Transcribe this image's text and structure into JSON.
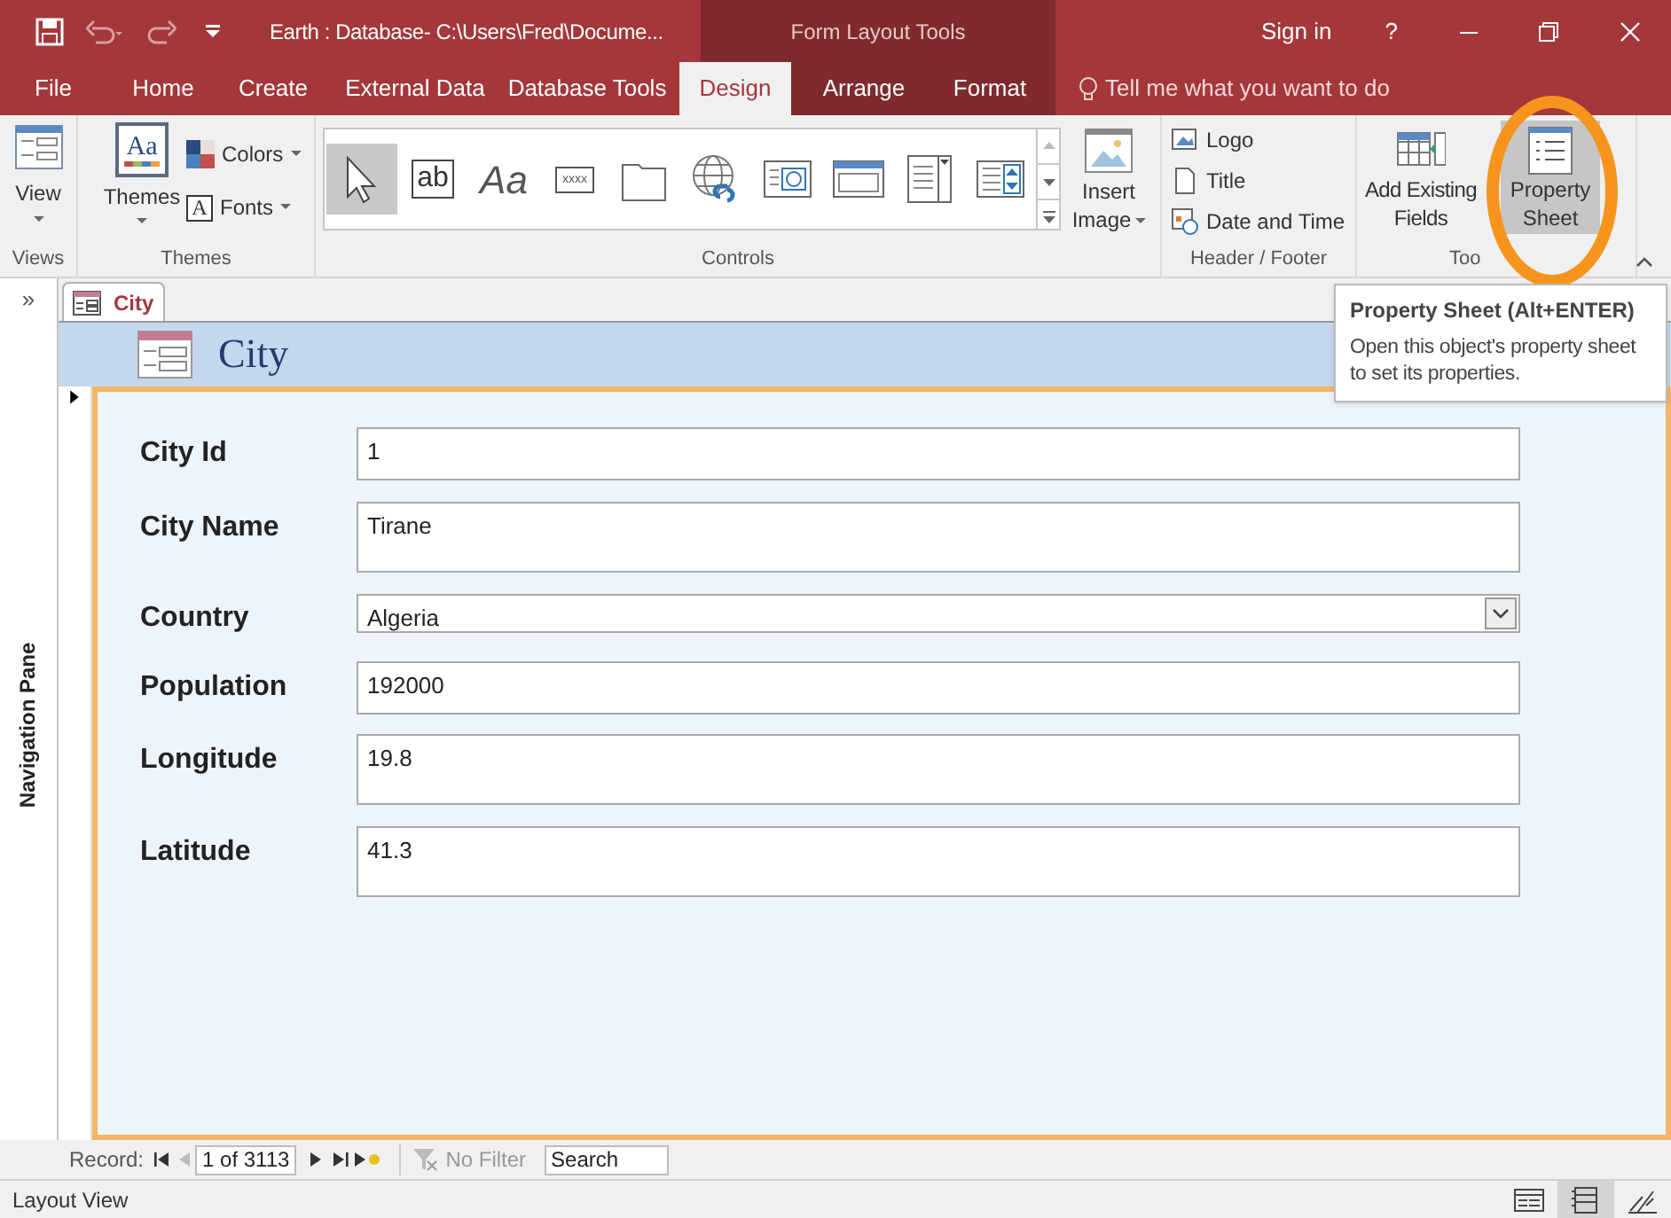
{
  "title_bar": {
    "title": "Earth : Database- C:\\Users\\Fred\\Docume...",
    "contextual_group": "Form Layout Tools",
    "sign_in": "Sign in",
    "help": "?",
    "undo_disabled": true
  },
  "ribbon_tabs": [
    {
      "label": "File",
      "selected": false
    },
    {
      "label": "Home",
      "selected": false
    },
    {
      "label": "Create",
      "selected": false
    },
    {
      "label": "External Data",
      "selected": false
    },
    {
      "label": "Database Tools",
      "selected": false
    },
    {
      "label": "Design",
      "selected": true
    },
    {
      "label": "Arrange",
      "selected": false
    },
    {
      "label": "Format",
      "selected": false
    }
  ],
  "tell_me": "Tell me what you want to do",
  "ribbon": {
    "views": {
      "label": "Views",
      "button": "View"
    },
    "themes": {
      "label": "Themes",
      "button": "Themes",
      "themes_glyph": "Aa",
      "colors": "Colors",
      "fonts": "Fonts",
      "fonts_glyph": "A"
    },
    "controls": {
      "label": "Controls",
      "items": [
        {
          "kind": "pointer",
          "selected": true
        },
        {
          "kind": "textbox",
          "glyph": "ab",
          "selected": false
        },
        {
          "kind": "label",
          "glyph": "Aa",
          "selected": false
        },
        {
          "kind": "button",
          "glyph": "xxxx",
          "selected": false
        },
        {
          "kind": "tab",
          "selected": false
        },
        {
          "kind": "hyperlink",
          "selected": false
        },
        {
          "kind": "web",
          "selected": false
        },
        {
          "kind": "navigation",
          "selected": false
        },
        {
          "kind": "listbox",
          "selected": false
        },
        {
          "kind": "combo",
          "selected": false
        }
      ]
    },
    "insert_image": "Insert Image",
    "header_footer": {
      "label": "Header / Footer",
      "items": [
        {
          "kind": "logo",
          "label": "Logo"
        },
        {
          "kind": "title",
          "label": "Title"
        },
        {
          "kind": "datetime",
          "label": "Date and Time"
        }
      ]
    },
    "tools": {
      "label": "Too",
      "buttons": [
        {
          "label": "Add Existing Fields",
          "selected": false
        },
        {
          "label": "Property Sheet",
          "selected": true
        }
      ]
    }
  },
  "tooltip": {
    "title": "Property Sheet (Alt+ENTER)",
    "text": "Open this object's property sheet to set its properties."
  },
  "nav_pane": {
    "label": "Navigation Pane",
    "toggle": "»"
  },
  "document_tab": {
    "label": "City",
    "selected": true
  },
  "form": {
    "title": "City",
    "fields": [
      {
        "label": "City Id",
        "value": "1",
        "kind": "text"
      },
      {
        "label": "City Name",
        "value": "Tirane",
        "kind": "tall"
      },
      {
        "label": "Country",
        "value": "Algeria",
        "kind": "combo"
      },
      {
        "label": "Population",
        "value": "192000",
        "kind": "text"
      },
      {
        "label": "Longitude",
        "value": "19.8",
        "kind": "tall"
      },
      {
        "label": "Latitude",
        "value": "41.3",
        "kind": "tall"
      }
    ]
  },
  "record_nav": {
    "label": "Record:",
    "position": "1 of 3113",
    "filter": "No Filter",
    "search_placeholder": "Search"
  },
  "status_bar": {
    "text": "Layout View",
    "views": [
      {
        "kind": "form",
        "selected": false
      },
      {
        "kind": "layout",
        "selected": true
      },
      {
        "kind": "design",
        "selected": false
      }
    ]
  }
}
